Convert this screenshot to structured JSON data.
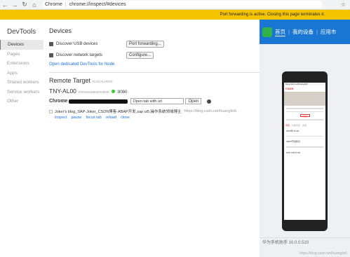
{
  "browser": {
    "tab_title": "Chrome",
    "url": "chrome://inspect/#devices",
    "back": "←",
    "forward": "→",
    "reload": "↻",
    "home": "⌂",
    "star": "☆"
  },
  "banner": {
    "text": "Port forwarding is active. Closing this page terminates it."
  },
  "sidebar": {
    "title": "DevTools",
    "items": [
      {
        "label": "Devices"
      },
      {
        "label": "Pages"
      },
      {
        "label": "Extensions"
      },
      {
        "label": "Apps"
      },
      {
        "label": "Shared workers"
      },
      {
        "label": "Service workers"
      },
      {
        "label": "Other"
      }
    ]
  },
  "devices": {
    "heading": "Devices",
    "usb_label": "Discover USB devices",
    "port_forwarding_btn": "Port forwarding...",
    "network_label": "Discover network targets",
    "configure_btn": "Configure...",
    "node_link": "Open dedicated DevTools for Node"
  },
  "remote": {
    "heading": "Remote Target",
    "sub": "#LOCALHOST",
    "device_name": "TNY-AL00",
    "serial": "#2XS0218803003509",
    "port": ":8080",
    "browser_label": "Chrome",
    "open_placeholder": "Open tab with url",
    "open_btn": "Open",
    "tab_title": "Joker's blog_SAP-Joker_CSDN博客-ABAP开发,sap ui5,操作系统领域博主",
    "tab_url": "https://blog.csdn.net/huanglin6",
    "actions": [
      "inspect",
      "pause",
      "focus tab",
      "reload",
      "close"
    ]
  },
  "phone_panel": {
    "nav": [
      "首页",
      "|",
      "我的设备",
      "|",
      "应用市"
    ],
    "footer": "华为手机助手 10.0.0.510",
    "watermark": "https://blog.csdn.net/huanglin6"
  },
  "phone_screen": {
    "bar_url": "blog.csdn.net/huanglin6",
    "brand": "CSDN",
    "follow": "关注",
    "tabs": [
      "博客",
      "分类专栏",
      "资源"
    ],
    "posts": [
      "2020年 PLAN",
      "ABAP开发知识",
      "SAP UI5 PLAN"
    ]
  }
}
